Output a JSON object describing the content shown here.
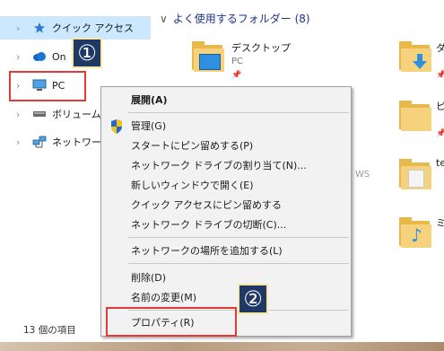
{
  "nav": {
    "items": [
      {
        "label": "クイック アクセス",
        "icon": "star-icon"
      },
      {
        "label": "On",
        "icon": "cloud-icon"
      },
      {
        "label": "PC",
        "icon": "computer-icon"
      },
      {
        "label": "ボリューム (D",
        "icon": "drive-icon"
      },
      {
        "label": "ネットワーク",
        "icon": "network-icon"
      }
    ]
  },
  "status": {
    "item_count": "13 個の項目"
  },
  "content": {
    "section_title": "よく使用するフォルダー (8)",
    "folders": [
      {
        "name": "デスクトップ",
        "sub": "PC"
      },
      {
        "name": "ダ",
        "sub": ""
      },
      {
        "name": "ピ",
        "sub": ""
      },
      {
        "name": "te",
        "sub": ""
      },
      {
        "name": "ミ",
        "sub": ""
      }
    ],
    "partial_text": "WS"
  },
  "context_menu": {
    "items": [
      "展開(A)",
      "管理(G)",
      "スタートにピン留めする(P)",
      "ネットワーク ドライブの割り当て(N)...",
      "新しいウィンドウで開く(E)",
      "クイック アクセスにピン留めする",
      "ネットワーク ドライブの切断(C)...",
      "ネットワークの場所を追加する(L)",
      "削除(D)",
      "名前の変更(M)",
      "プロパティ(R)"
    ]
  },
  "callouts": {
    "one": "①",
    "two": "②"
  },
  "colors": {
    "selection": "#cce8ff",
    "folder": "#f6d27c",
    "callout_bg": "#1f3864",
    "highlight_box": "#e53935"
  }
}
